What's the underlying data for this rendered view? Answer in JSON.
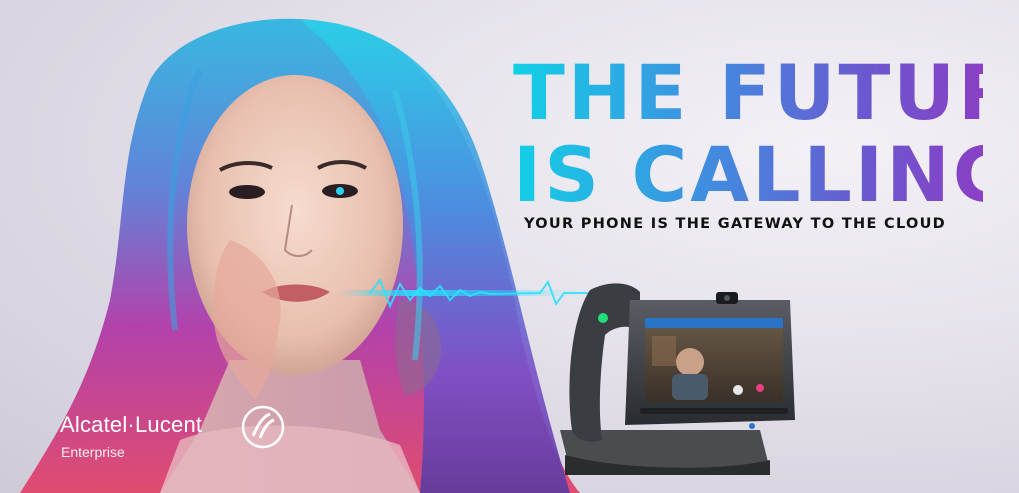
{
  "headline": {
    "line1": "THE FUTURE",
    "line2": "IS CALLING"
  },
  "subline": "YOUR PHONE IS THE GATEWAY TO THE CLOUD",
  "brand": {
    "name": "Alcatel·Lucent",
    "sub": "Enterprise",
    "logo_icon": "alcatel-lucent-logo-icon"
  },
  "colors": {
    "headline_start": "#12d0e6",
    "headline_end": "#8a3fc4",
    "subline": "#111111",
    "brand_text": "#ffffff"
  }
}
